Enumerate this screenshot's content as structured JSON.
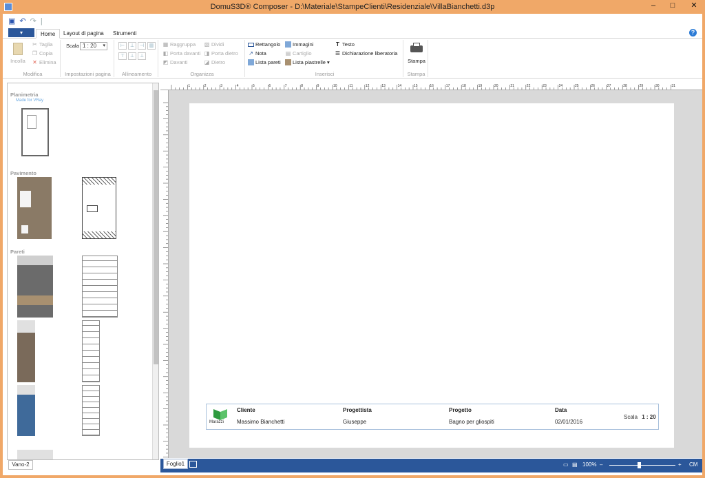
{
  "window": {
    "title": "DomuS3D® Composer - D:\\Materiale\\StampeClienti\\Residenziale\\VillaBianchetti.d3p"
  },
  "tabs": [
    {
      "label": "Home"
    },
    {
      "label": "Layout di pagina"
    },
    {
      "label": "Strumenti"
    }
  ],
  "ribbon": {
    "modifica": {
      "label": "Modifica",
      "incolla": "Incolla",
      "taglia": "Taglia",
      "copia": "Copia",
      "elimina": "Elimina"
    },
    "impostazioni": {
      "label": "Impostazioni pagina",
      "scala_label": "Scala",
      "scala_value": "1 : 20"
    },
    "allineamento": {
      "label": "Allineamento"
    },
    "organizza": {
      "label": "Organizza",
      "raggruppa": "Raggruppa",
      "dividi": "Dividi",
      "porta_davanti": "Porta davanti",
      "porta_dietro": "Porta dietro",
      "davanti": "Davanti",
      "dietro": "Dietro"
    },
    "inserisci": {
      "label": "Inserisci",
      "rettangolo": "Rettangolo",
      "immagini": "Immagini",
      "testo": "Testo",
      "nota": "Nota",
      "cartiglio": "Cartiglio",
      "dichiarazione": "Dichiarazione liberatoria",
      "lista_pareti": "Lista pareti",
      "lista_piastrelle": "Lista piastrelle"
    },
    "stampa": {
      "label": "Stampa",
      "stampa": "Stampa"
    }
  },
  "sidepanel": {
    "sections": [
      {
        "label": "Planimetria"
      },
      {
        "label": "Pavimento"
      },
      {
        "label": "Pareti"
      }
    ],
    "planimetria_thumb_title": "Made for VRay"
  },
  "vano_tab": "Vano-2",
  "titleblock": {
    "cliente_label": "Cliente",
    "cliente": "Massimo Bianchetti",
    "progettista_label": "Progettista",
    "progettista": "Giuseppe",
    "progetto_label": "Progetto",
    "progetto": "Bagno per gliospiti",
    "data_label": "Data",
    "data": "02/01/2016",
    "scala_label": "Scala",
    "scala": "1 : 20",
    "logo_text": "Marazzi"
  },
  "status": {
    "sheet": "Foglio1",
    "zoom": "100%",
    "unit": "CM",
    "zoom_fraction": 0.43
  },
  "ruler": {
    "top_ticks": [
      "1",
      "2",
      "3",
      "4",
      "5",
      "6",
      "7",
      "8",
      "9",
      "10",
      "11",
      "12",
      "13",
      "14",
      "15",
      "16",
      "17",
      "18",
      "19",
      "20",
      "21",
      "22",
      "23",
      "24",
      "25",
      "26",
      "27",
      "28",
      "29",
      "30",
      "31"
    ]
  },
  "colors": {
    "accent": "#2b579a",
    "titlebar": "#f0a868",
    "canvas": "#d9d9d9"
  }
}
